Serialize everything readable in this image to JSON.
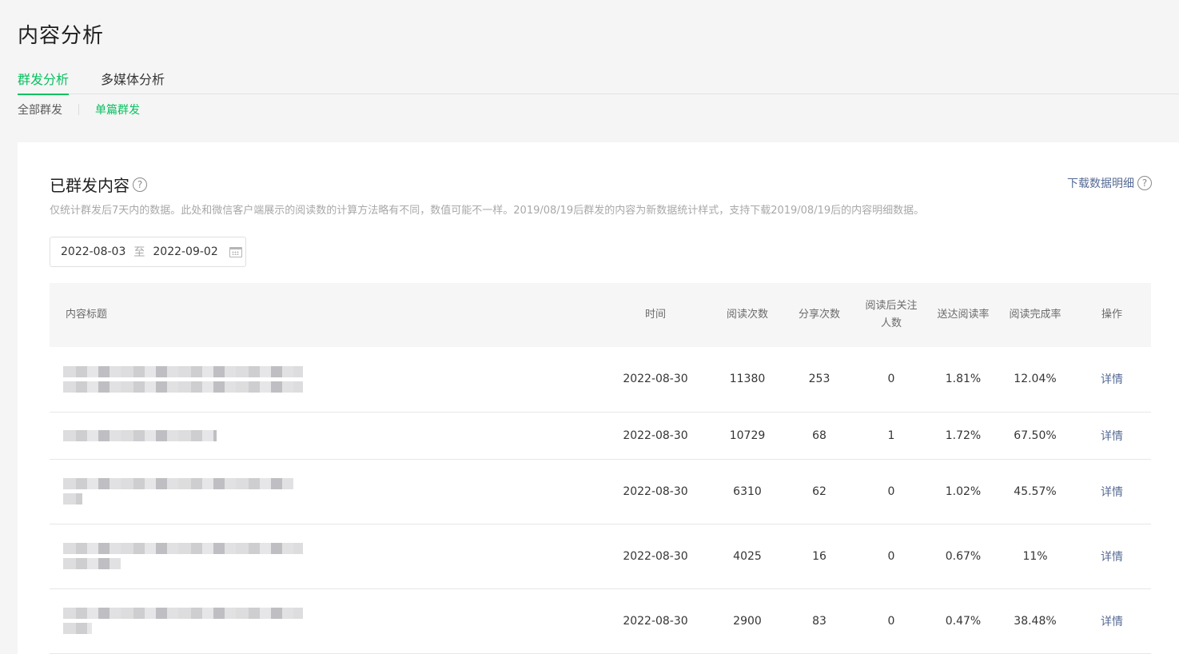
{
  "header": {
    "title": "内容分析"
  },
  "tabs": [
    {
      "label": "群发分析",
      "active": true
    },
    {
      "label": "多媒体分析",
      "active": false
    }
  ],
  "subtabs": [
    {
      "label": "全部群发",
      "active": false
    },
    {
      "label": "单篇群发",
      "active": true
    }
  ],
  "card": {
    "title": "已群发内容",
    "download_label": "下载数据明细",
    "description": "仅统计群发后7天内的数据。此处和微信客户端展示的阅读数的计算方法略有不同，数值可能不一样。2019/08/19后群发的内容为新数据统计样式，支持下载2019/08/19后的内容明细数据。",
    "date_start": "2022-08-03",
    "date_sep": "至",
    "date_end": "2022-09-02"
  },
  "table": {
    "columns": [
      "内容标题",
      "时间",
      "阅读次数",
      "分享次数",
      "阅读后关注人数",
      "送达阅读率",
      "阅读完成率",
      "操作"
    ],
    "rows": [
      {
        "time": "2022-08-30",
        "reads": "11380",
        "shares": "253",
        "follows": "0",
        "delivery_rate": "1.81%",
        "completion_rate": "12.04%",
        "action": "详情"
      },
      {
        "time": "2022-08-30",
        "reads": "10729",
        "shares": "68",
        "follows": "1",
        "delivery_rate": "1.72%",
        "completion_rate": "67.50%",
        "action": "详情"
      },
      {
        "time": "2022-08-30",
        "reads": "6310",
        "shares": "62",
        "follows": "0",
        "delivery_rate": "1.02%",
        "completion_rate": "45.57%",
        "action": "详情"
      },
      {
        "time": "2022-08-30",
        "reads": "4025",
        "shares": "16",
        "follows": "0",
        "delivery_rate": "0.67%",
        "completion_rate": "11%",
        "action": "详情"
      },
      {
        "time": "2022-08-30",
        "reads": "2900",
        "shares": "83",
        "follows": "0",
        "delivery_rate": "0.47%",
        "completion_rate": "38.48%",
        "action": "详情"
      }
    ]
  },
  "colors": {
    "accent": "#07c160",
    "link": "#576b95"
  },
  "icons": {
    "help": "question-circle-icon",
    "calendar": "calendar-icon"
  }
}
